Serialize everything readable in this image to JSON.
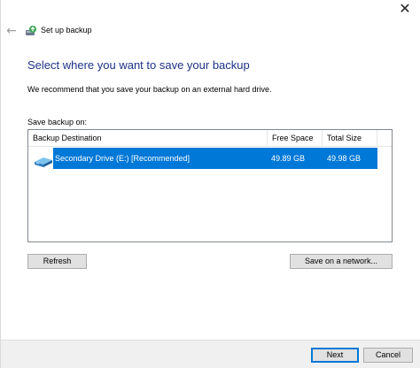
{
  "window": {
    "title": "Set up backup",
    "close_glyph": "✕",
    "back_glyph": "←"
  },
  "main": {
    "heading": "Select where you want to save your backup",
    "description": "We recommend that you save your backup on an external hard drive.",
    "save_label": "Save backup on:"
  },
  "table": {
    "columns": [
      "Backup Destination",
      "Free Space",
      "Total Size"
    ],
    "rows": [
      {
        "destination": "Secondary Drive (E:) [Recommended]",
        "free_space": "49.89 GB",
        "total_size": "49.98 GB",
        "selected": true,
        "icon": "drive-icon"
      }
    ]
  },
  "buttons": {
    "refresh": "Refresh",
    "save_network": "Save on a network...",
    "next": "Next",
    "cancel": "Cancel"
  },
  "icons": {
    "back": "back-arrow-icon",
    "title": "backup-icon",
    "close": "close-icon"
  },
  "colors": {
    "heading": "#1e3287",
    "selection": "#0078d7",
    "button_face": "#e1e1e1",
    "footer": "#f0f0f0"
  }
}
